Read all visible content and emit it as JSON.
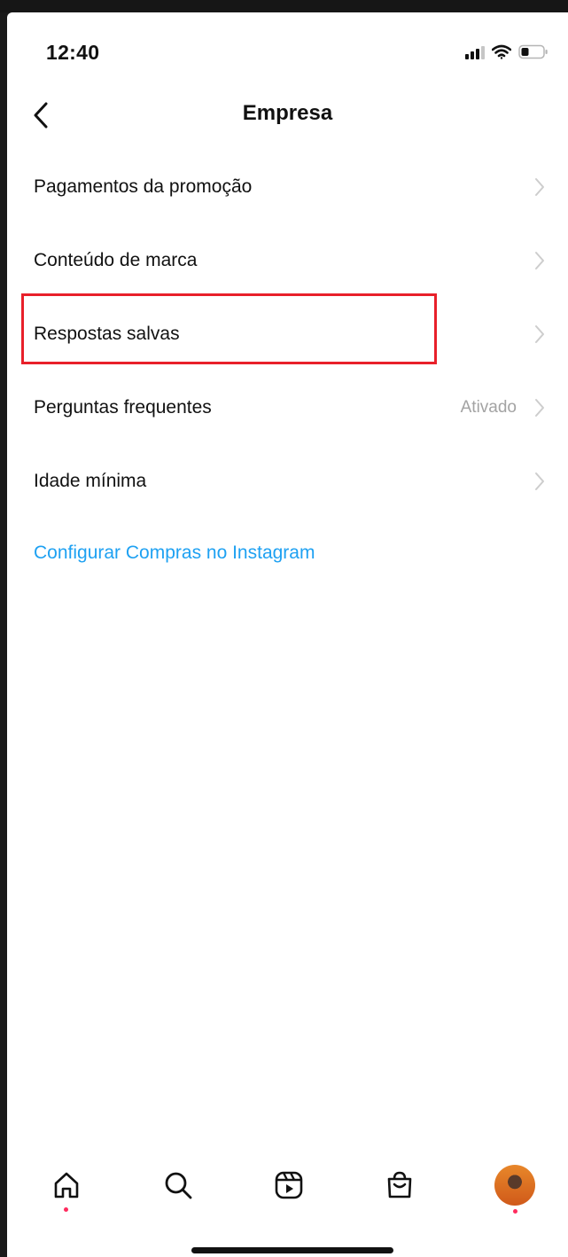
{
  "status_bar": {
    "time": "12:40"
  },
  "header": {
    "title": "Empresa"
  },
  "menu": {
    "items": [
      {
        "label": "Pagamentos da promoção",
        "value": ""
      },
      {
        "label": "Conteúdo de marca",
        "value": ""
      },
      {
        "label": "Respostas salvas",
        "value": ""
      },
      {
        "label": "Perguntas frequentes",
        "value": "Ativado"
      },
      {
        "label": "Idade mínima",
        "value": ""
      }
    ],
    "link": "Configurar Compras no Instagram"
  },
  "tab_bar": {
    "icons": [
      "home-icon",
      "search-icon",
      "reels-icon",
      "shop-icon",
      "profile-avatar"
    ]
  },
  "colors": {
    "link": "#1ea1f2",
    "highlight": "#e8202a",
    "notification_dot": "#ff2b5e"
  }
}
